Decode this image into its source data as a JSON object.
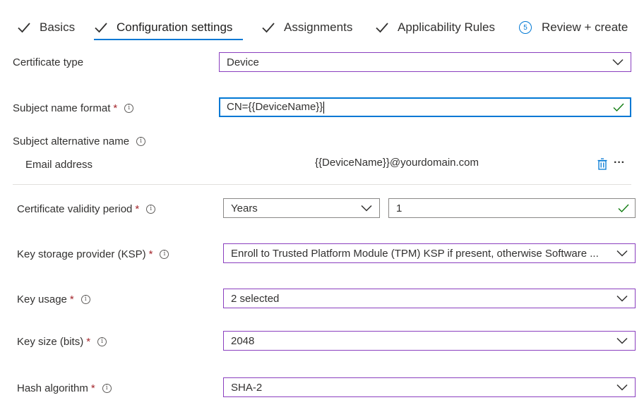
{
  "tabs": [
    {
      "label": "Basics",
      "state": "done"
    },
    {
      "label": "Configuration settings",
      "state": "active"
    },
    {
      "label": "Assignments",
      "state": "done"
    },
    {
      "label": "Applicability Rules",
      "state": "done"
    },
    {
      "label": "Review + create",
      "state": "pending",
      "step": "5"
    }
  ],
  "fields": {
    "certificate_type": {
      "label": "Certificate type",
      "value": "Device"
    },
    "subject_name_format": {
      "label": "Subject name format",
      "value": "CN={{DeviceName}}"
    },
    "subject_alt_name": {
      "label": "Subject alternative name",
      "row_label": "Email address",
      "row_value": "{{DeviceName}}@yourdomain.com"
    },
    "validity_period": {
      "label": "Certificate validity period",
      "unit": "Years",
      "value": "1"
    },
    "ksp": {
      "label": "Key storage provider (KSP)",
      "value": "Enroll to Trusted Platform Module (TPM) KSP if present, otherwise Software ..."
    },
    "key_usage": {
      "label": "Key usage",
      "value": "2 selected"
    },
    "key_size": {
      "label": "Key size (bits)",
      "value": "2048"
    },
    "hash_algorithm": {
      "label": "Hash algorithm",
      "value": "SHA-2"
    }
  },
  "required_marker": "*",
  "info_glyph": "i",
  "more_glyph": "···",
  "colors": {
    "accent": "#0078d4",
    "select_border": "#8a3fbf",
    "required": "#a4262c",
    "valid": "#107c10"
  }
}
